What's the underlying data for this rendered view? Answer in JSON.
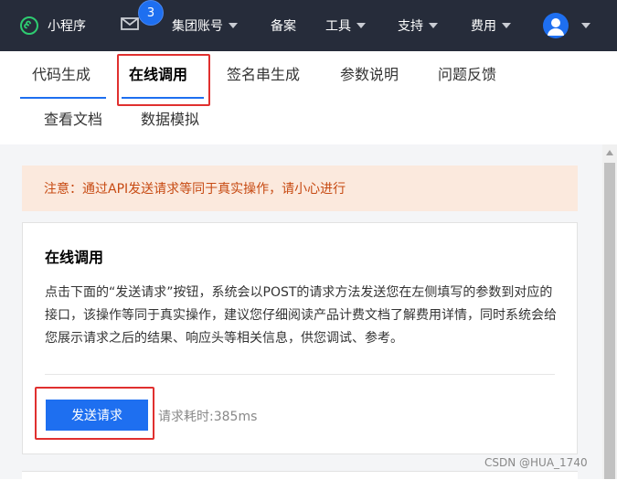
{
  "topbar": {
    "brand_label": "小程序",
    "notification_count": "3",
    "menu": {
      "group_account": "集团账号",
      "filing": "备案",
      "tools": "工具",
      "support": "支持",
      "fees": "费用"
    }
  },
  "tabs": {
    "code_gen": "代码生成",
    "online_call": "在线调用",
    "signature_gen": "签名串生成",
    "param_desc": "参数说明",
    "feedback": "问题反馈",
    "view_docs": "查看文档",
    "data_mock": "数据模拟",
    "active": "在线调用"
  },
  "notice": {
    "text": "注意：通过API发送请求等同于真实操作，请小心进行"
  },
  "card": {
    "title": "在线调用",
    "description": "点击下面的“发送请求”按钮，系统会以POST的请求方法发送您在左侧填写的参数到对应的接口，该操作等同于真实操作，建议您仔细阅读产品计费文档了解费用详情，同时系统会给您展示请求之后的结果、响应头等相关信息，供您调试、参考。",
    "send_button": "发送请求",
    "timing_text": "请求耗时:385ms"
  },
  "watermark": "CSDN @HUA_1740",
  "colors": {
    "topbar_bg": "#262c3a",
    "accent": "#1e6ff0",
    "notice_bg": "#fbe9dd",
    "notice_text": "#c74a12",
    "highlight_box": "#e0302f",
    "brand_icon": "#2ecc71"
  }
}
